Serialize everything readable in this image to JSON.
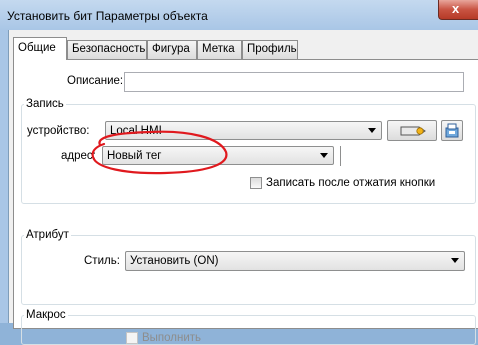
{
  "window": {
    "title": "Установить бит Параметры объекта",
    "close_glyph": "x"
  },
  "tabs": [
    {
      "label": "Общие",
      "active": true
    },
    {
      "label": "Безопасность",
      "active": false
    },
    {
      "label": "Фигура",
      "active": false
    },
    {
      "label": "Метка",
      "active": false
    },
    {
      "label": "Профиль",
      "active": false
    }
  ],
  "general": {
    "description_label": "Описание:",
    "description_value": ""
  },
  "record": {
    "group_title": "Запись",
    "device_label": "устройство:",
    "device_value": "Local HMI",
    "address_label": "адрес:",
    "address_value": "Новый тег",
    "write_after_release_label": "Записать после отжатия кнопки",
    "write_after_release_checked": false
  },
  "attribute": {
    "group_title": "Атрибут",
    "style_label": "Стиль:",
    "style_value": "Установить (ON)"
  },
  "macro": {
    "group_title": "Макрос",
    "execute_label": "Выполнить",
    "execute_checked": false,
    "execute_enabled": false
  },
  "annotation": {
    "color": "#e0191e"
  }
}
